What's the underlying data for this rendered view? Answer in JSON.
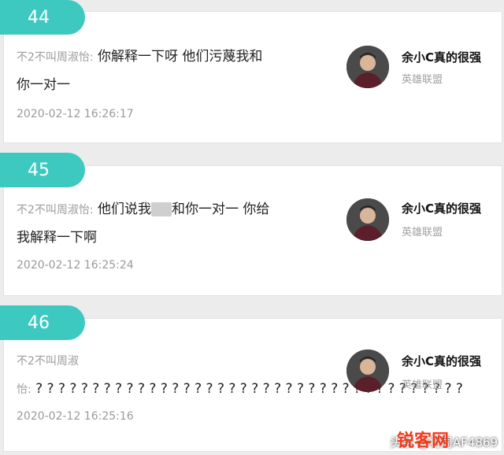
{
  "comments": [
    {
      "number": "44",
      "sender": "不2不叫周淑怡:",
      "line1": " 你解释一下呀 他们污蔑我和",
      "line2": "你一对一",
      "date": "2020-02-12 16:26:17",
      "user_name": "余小C真的很强",
      "user_game": "英雄联盟"
    },
    {
      "number": "45",
      "sender": "不2不叫周淑怡:",
      "line1_a": " 他们说我",
      "line1_b": "和你一对一 你给",
      "line2": "我解释一下啊",
      "date": "2020-02-12 16:25:24",
      "user_name": "余小C真的很强",
      "user_game": "英雄联盟"
    },
    {
      "number": "46",
      "sender_line1": "不2不叫周淑",
      "sender_line2": "怡:",
      "line2_text": " ? ? ? ? ? ? ? ? ? ? ? ? ? ? ? ? ? ? ? ? ? ? ? ? ? ? ? ? ? ? ? ? ? ? ? ? ? ?",
      "date": "2020-02-12 16:25:16",
      "user_name": "余小C真的很强",
      "user_game": "英雄联盟"
    }
  ],
  "watermark": {
    "text": "头条 @将周AF4869",
    "logo": "锐客网"
  },
  "colors": {
    "tab": "#3ec9c0",
    "logo": "#f23b1c"
  }
}
